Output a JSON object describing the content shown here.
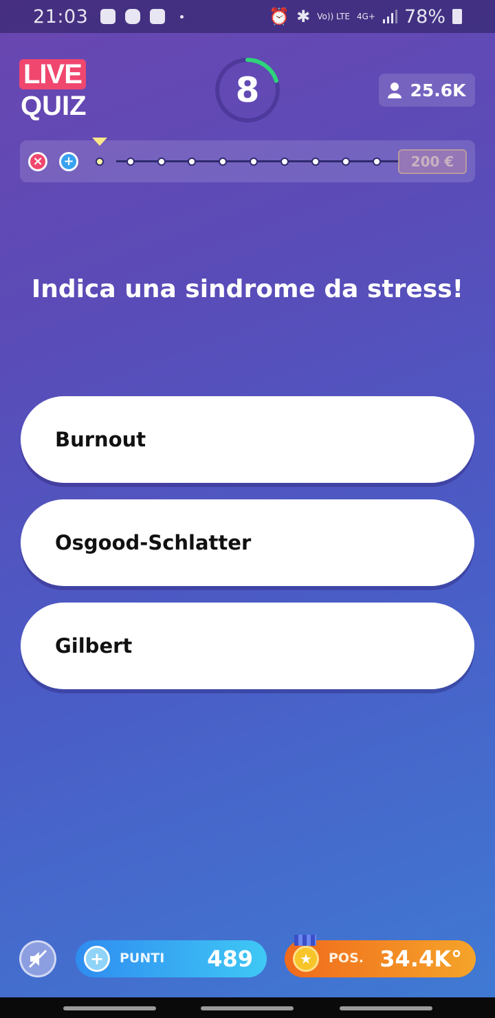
{
  "status_bar": {
    "time": "21:03",
    "volte": "Vo)) LTE",
    "network": "4G+",
    "battery": "78%"
  },
  "header": {
    "logo_line1": "LIVE",
    "logo_line2": "QUIZ",
    "timer": "8",
    "timer_fraction": 0.2,
    "players": "25.6K"
  },
  "progress": {
    "current_step": 1,
    "total_steps": 10,
    "prize": "200 €"
  },
  "question": "Indica una sindrome da stress!",
  "answers": [
    {
      "label": "Burnout"
    },
    {
      "label": "Osgood-Schlatter"
    },
    {
      "label": "Gilbert"
    }
  ],
  "footer": {
    "points_label": "PUNTI",
    "points_value": "489",
    "position_label": "POS.",
    "position_value": "34.4K°"
  },
  "colors": {
    "accent_pink": "#f0476f",
    "timer_green": "#2ed47a",
    "points_blue": "#2f8cf0",
    "position_orange": "#f06a1c"
  }
}
